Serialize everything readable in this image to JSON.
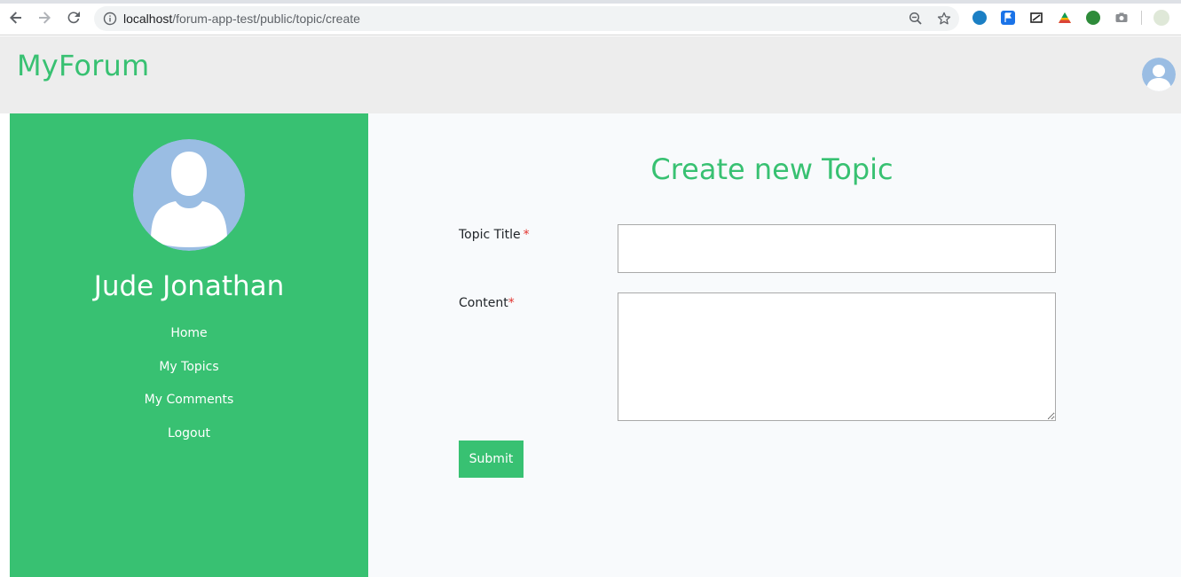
{
  "browser": {
    "url_host": "localhost",
    "url_path": "/forum-app-test/public/topic/create",
    "icons": [
      "back-arrow-icon",
      "forward-arrow-icon",
      "reload-icon",
      "info-icon",
      "zoom-icon",
      "star-icon"
    ],
    "extensions": [
      "extension-icon-1",
      "extension-icon-2",
      "extension-icon-3",
      "extension-icon-4",
      "extension-icon-5",
      "camera-icon",
      "profile-icon"
    ]
  },
  "header": {
    "brand": "MyForum"
  },
  "sidebar": {
    "user_name": "Jude Jonathan",
    "nav": [
      {
        "label": "Home"
      },
      {
        "label": "My Topics"
      },
      {
        "label": "My Comments"
      },
      {
        "label": "Logout"
      }
    ]
  },
  "main": {
    "title": "Create new Topic",
    "form": {
      "title_label": "Topic Title",
      "title_value": "",
      "content_label": "Content",
      "content_value": "",
      "required_mark": "*",
      "submit_label": "Submit"
    }
  },
  "colors": {
    "accent": "#38c172",
    "header_bg": "#ededed",
    "main_bg": "#f8fafc",
    "avatar_blue": "#9abde3",
    "required": "#e3342f"
  }
}
